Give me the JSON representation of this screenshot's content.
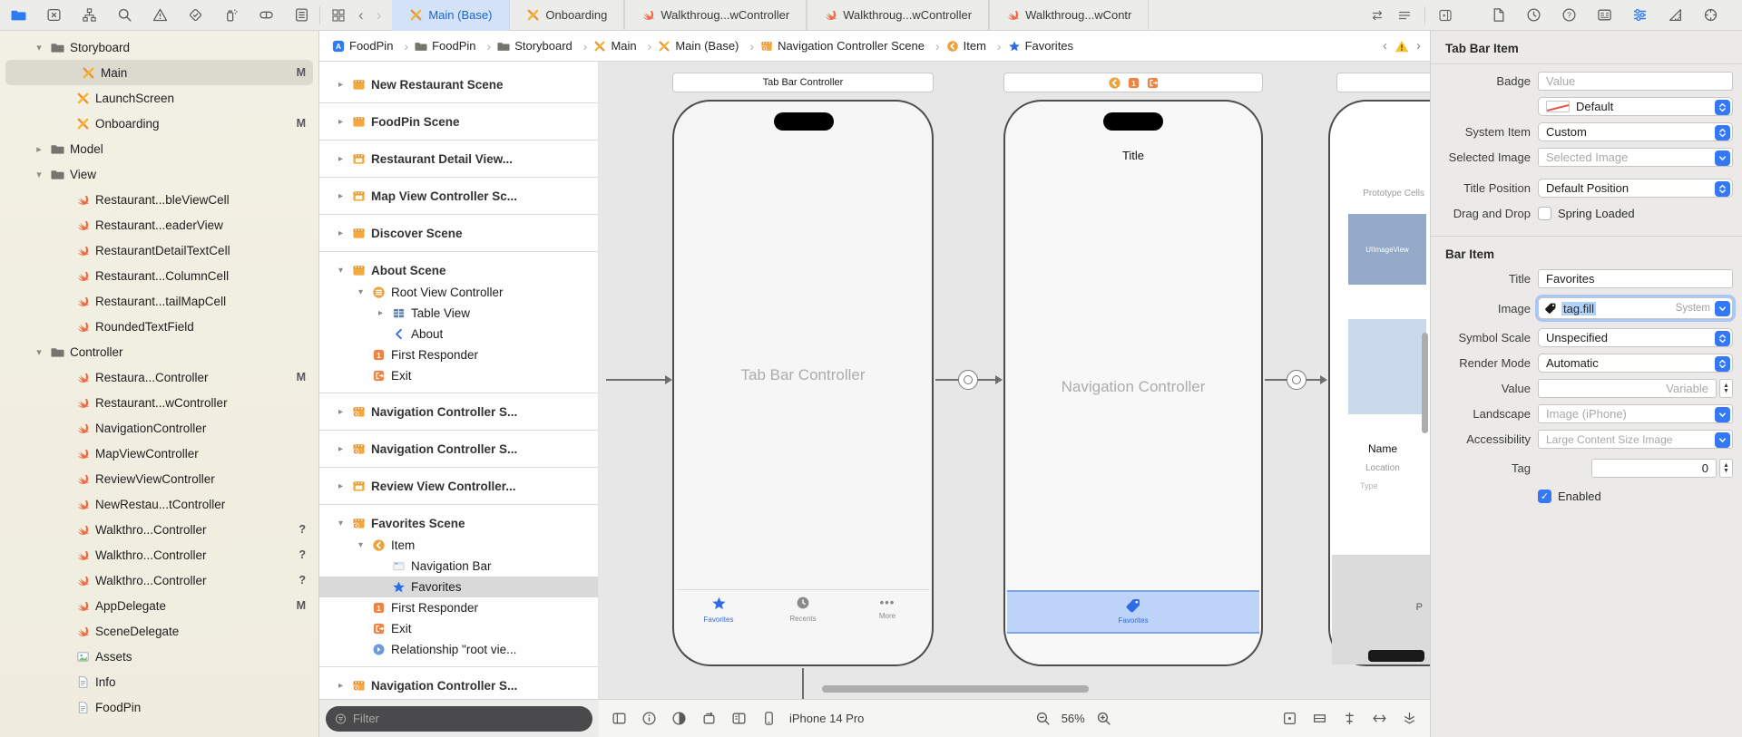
{
  "toolbar": {
    "tabs": [
      {
        "icon": "storyboard",
        "label": "Main (Base)",
        "selected": true
      },
      {
        "icon": "storyboard",
        "label": "Onboarding"
      },
      {
        "icon": "swift",
        "label": "Walkthroug...wController"
      },
      {
        "icon": "swift",
        "label": "Walkthroug...wController"
      },
      {
        "icon": "swift",
        "label": "Walkthroug...wContr"
      }
    ]
  },
  "jumpbar": {
    "crumbs": [
      {
        "icon": "appicon",
        "label": "FoodPin"
      },
      {
        "icon": "folder",
        "label": "FoodPin"
      },
      {
        "icon": "folder",
        "label": "Storyboard"
      },
      {
        "icon": "storyboard",
        "label": "Main"
      },
      {
        "icon": "storyboard",
        "label": "Main (Base)"
      },
      {
        "icon": "scene-nav",
        "label": "Navigation Controller Scene"
      },
      {
        "icon": "item",
        "label": "Item"
      },
      {
        "icon": "star",
        "label": "Favorites"
      }
    ]
  },
  "navigator": {
    "items": [
      {
        "indent": 1,
        "chevron": "down",
        "icon": "folder",
        "label": "Storyboard"
      },
      {
        "indent": 2,
        "icon": "storyboard",
        "label": "Main",
        "badge": "M",
        "selected": true
      },
      {
        "indent": 2,
        "icon": "storyboard",
        "label": "LaunchScreen"
      },
      {
        "indent": 2,
        "icon": "storyboard",
        "label": "Onboarding",
        "badge": "M"
      },
      {
        "indent": 1,
        "chevron": "right",
        "icon": "folder",
        "label": "Model"
      },
      {
        "indent": 1,
        "chevron": "down",
        "icon": "folder",
        "label": "View"
      },
      {
        "indent": 2,
        "icon": "swift",
        "label": "Restaurant...bleViewCell"
      },
      {
        "indent": 2,
        "icon": "swift",
        "label": "Restaurant...eaderView"
      },
      {
        "indent": 2,
        "icon": "swift",
        "label": "RestaurantDetailTextCell"
      },
      {
        "indent": 2,
        "icon": "swift",
        "label": "Restaurant...ColumnCell"
      },
      {
        "indent": 2,
        "icon": "swift",
        "label": "Restaurant...tailMapCell"
      },
      {
        "indent": 2,
        "icon": "swift",
        "label": "RoundedTextField"
      },
      {
        "indent": 1,
        "chevron": "down",
        "icon": "folder",
        "label": "Controller"
      },
      {
        "indent": 2,
        "icon": "swift",
        "label": "Restaura...Controller",
        "badge": "M"
      },
      {
        "indent": 2,
        "icon": "swift",
        "label": "Restaurant...wController"
      },
      {
        "indent": 2,
        "icon": "swift",
        "label": "NavigationController"
      },
      {
        "indent": 2,
        "icon": "swift",
        "label": "MapViewController"
      },
      {
        "indent": 2,
        "icon": "swift",
        "label": "ReviewViewController"
      },
      {
        "indent": 2,
        "icon": "swift",
        "label": "NewRestau...tController"
      },
      {
        "indent": 2,
        "icon": "swift",
        "label": "Walkthro...Controller",
        "badge": "?"
      },
      {
        "indent": 2,
        "icon": "swift",
        "label": "Walkthro...Controller",
        "badge": "?"
      },
      {
        "indent": 2,
        "icon": "swift",
        "label": "Walkthro...Controller",
        "badge": "?"
      },
      {
        "indent": 2,
        "icon": "swift",
        "label": "AppDelegate",
        "badge": "M"
      },
      {
        "indent": 2,
        "icon": "swift",
        "label": "SceneDelegate"
      },
      {
        "indent": 2,
        "icon": "assets",
        "label": "Assets"
      },
      {
        "indent": 2,
        "icon": "plist",
        "label": "Info"
      },
      {
        "indent": 2,
        "icon": "plist",
        "label": "FoodPin"
      }
    ]
  },
  "outline": {
    "filter_placeholder": "Filter",
    "items": [
      {
        "indent": 0,
        "scene": true,
        "chevron": "right",
        "icon": "scene",
        "label": "New Restaurant Scene"
      },
      {
        "indent": 0,
        "scene": true,
        "chevron": "right",
        "icon": "scene",
        "label": "FoodPin Scene",
        "sepBefore": true
      },
      {
        "indent": 0,
        "scene": true,
        "chevron": "right",
        "icon": "scene-vc",
        "label": "Restaurant Detail View...",
        "sepBefore": true
      },
      {
        "indent": 0,
        "scene": true,
        "chevron": "right",
        "icon": "scene-vc",
        "label": "Map View Controller Sc...",
        "sepBefore": true
      },
      {
        "indent": 0,
        "scene": true,
        "chevron": "right",
        "icon": "scene",
        "label": "Discover Scene",
        "sepBefore": true
      },
      {
        "indent": 0,
        "scene": true,
        "chevron": "down",
        "icon": "scene",
        "label": "About Scene",
        "sepBefore": true
      },
      {
        "indent": 1,
        "chevron": "down",
        "icon": "rootvc",
        "label": "Root View Controller"
      },
      {
        "indent": 2,
        "chevron": "right",
        "icon": "table",
        "label": "Table View"
      },
      {
        "indent": 2,
        "icon": "backchip",
        "label": "About"
      },
      {
        "indent": 1,
        "icon": "fr",
        "label": "First Responder"
      },
      {
        "indent": 1,
        "icon": "exit",
        "label": "Exit"
      },
      {
        "indent": 0,
        "scene": true,
        "chevron": "right",
        "icon": "scene-nav",
        "label": "Navigation Controller S...",
        "sepBefore": true
      },
      {
        "indent": 0,
        "scene": true,
        "chevron": "right",
        "icon": "scene-nav",
        "label": "Navigation Controller S...",
        "sepBefore": true
      },
      {
        "indent": 0,
        "scene": true,
        "chevron": "right",
        "icon": "scene-vc",
        "label": "Review View Controller...",
        "sepBefore": true
      },
      {
        "indent": 0,
        "scene": true,
        "chevron": "down",
        "icon": "scene-nav",
        "label": "Favorites Scene",
        "sepBefore": true
      },
      {
        "indent": 1,
        "chevron": "down",
        "icon": "item",
        "label": "Item"
      },
      {
        "indent": 2,
        "icon": "navbar",
        "label": "Navigation Bar"
      },
      {
        "indent": 2,
        "icon": "star",
        "label": "Favorites",
        "selected": true
      },
      {
        "indent": 1,
        "icon": "fr",
        "label": "First Responder"
      },
      {
        "indent": 1,
        "icon": "exit",
        "label": "Exit"
      },
      {
        "indent": 1,
        "icon": "relationship",
        "label": "Relationship \"root vie..."
      },
      {
        "indent": 0,
        "scene": true,
        "chevron": "right",
        "icon": "scene-nav",
        "label": "Navigation Controller S...",
        "sepBefore": true
      },
      {
        "indent": 0,
        "scene": true,
        "chevron": "right",
        "icon": "scene",
        "label": "",
        "clipped": true,
        "sepBefore": true
      }
    ]
  },
  "canvas": {
    "scene1": {
      "header_label": "Tab Bar Controller",
      "center_label": "Tab Bar Controller",
      "tab1": "Favorites",
      "tab2": "Recents",
      "tab3": "More"
    },
    "scene2": {
      "title": "Title",
      "center_label": "Navigation Controller",
      "selected_tab": "Favorites"
    },
    "scene3": {
      "prototype_label": "Prototype Cells",
      "imageview_label": "UIImageView",
      "name_label": "Name",
      "location_label": "Location",
      "type_label": "Type",
      "partial_text": "P"
    }
  },
  "device_bar": {
    "device": "iPhone 14 Pro",
    "zoom": "56%"
  },
  "inspector": {
    "section1": "Tab Bar Item",
    "badge_label": "Badge",
    "badge_placeholder": "Value",
    "appearance_value": "Default",
    "system_item_label": "System Item",
    "system_item_value": "Custom",
    "selected_image_label": "Selected Image",
    "selected_image_placeholder": "Selected Image",
    "title_position_label": "Title Position",
    "title_position_value": "Default Position",
    "drag_drop_label": "Drag and Drop",
    "spring_loaded_label": "Spring Loaded",
    "section2": "Bar Item",
    "title_label": "Title",
    "title_value": "Favorites",
    "image_label": "Image",
    "image_value": "tag.fill",
    "image_tag": "System",
    "symbol_scale_label": "Symbol Scale",
    "symbol_scale_value": "Unspecified",
    "render_mode_label": "Render Mode",
    "render_mode_value": "Automatic",
    "value_label": "Value",
    "value_placeholder": "Variable",
    "landscape_label": "Landscape",
    "landscape_placeholder": "Image (iPhone)",
    "accessibility_label": "Accessibility",
    "accessibility_placeholder": "Large Content Size Image",
    "tag_label": "Tag",
    "tag_value": "0",
    "enabled_label": "Enabled"
  }
}
